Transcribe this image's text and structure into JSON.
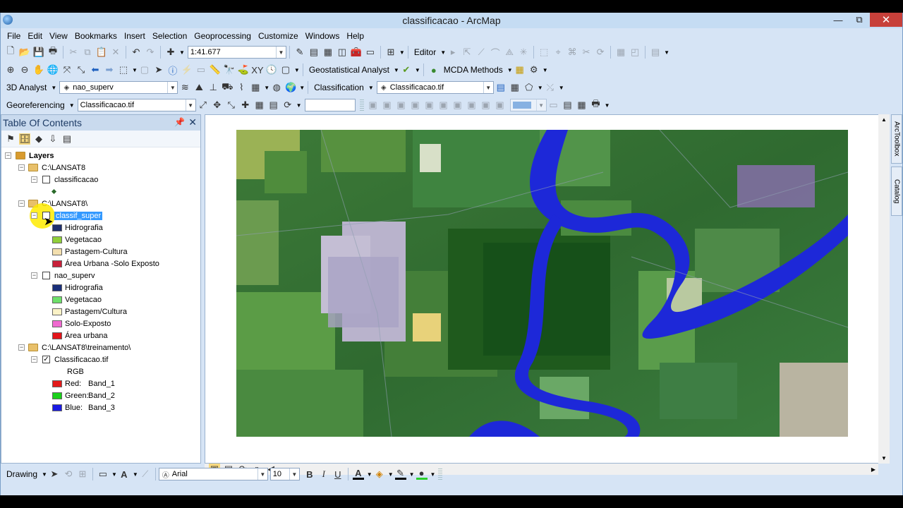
{
  "window": {
    "title": "classificacao - ArcMap",
    "minimize": "—",
    "restore": "⧉",
    "close": "✕"
  },
  "menu": [
    "File",
    "Edit",
    "View",
    "Bookmarks",
    "Insert",
    "Selection",
    "Geoprocessing",
    "Customize",
    "Windows",
    "Help"
  ],
  "toolbar1": {
    "scale": "1:41.677",
    "editor": "Editor"
  },
  "toolbar2": {
    "geostat": "Geostatistical Analyst",
    "mcda": "MCDA Methods"
  },
  "toolbar3": {
    "analyst3d": "3D Analyst",
    "layer3d": "nao_superv",
    "classification": "Classification",
    "class_layer": "Classificacao.tif"
  },
  "toolbar4": {
    "georef": "Georeferencing",
    "georef_layer": "Classificacao.tif"
  },
  "toc": {
    "title": "Table Of Contents",
    "root": "Layers",
    "groups": [
      {
        "path": "C:\\LANSAT8",
        "layers": [
          {
            "name": "classificacao"
          }
        ]
      },
      {
        "path": "C:\\LANSAT8\\",
        "layers": [
          {
            "name": "classif_super",
            "classes": [
              {
                "label": "Hidrografia",
                "color": "#1f2f6e"
              },
              {
                "label": "Vegetacao",
                "color": "#8fcf3a"
              },
              {
                "label": "Pastagem-Cultura",
                "color": "#f3dfae"
              },
              {
                "label": "Área Urbana -Solo Exposto",
                "color": "#c8213a"
              }
            ]
          },
          {
            "name": "nao_superv",
            "classes": [
              {
                "label": "Hidrografia",
                "color": "#1a2f7a"
              },
              {
                "label": "Vegetacao",
                "color": "#6ee06a"
              },
              {
                "label": "Pastagem/Cultura",
                "color": "#fbf2c6"
              },
              {
                "label": "Solo-Exposto",
                "color": "#f06ad0"
              },
              {
                "label": "Área urbana",
                "color": "#e3141a"
              }
            ]
          }
        ]
      },
      {
        "path": "C:\\LANSAT8\\treinamento\\",
        "layers": [
          {
            "name": "Classificacao.tif",
            "rgb_label": "RGB",
            "bands": [
              {
                "label": "Red:",
                "band": "Band_1",
                "color": "#e31a1a"
              },
              {
                "label": "Green:",
                "band": "Band_2",
                "color": "#1ad01a"
              },
              {
                "label": "Blue:",
                "band": "Band_3",
                "color": "#1a1ae3"
              }
            ]
          }
        ]
      }
    ]
  },
  "sidetabs": [
    "ArcToolbox",
    "Catalog"
  ],
  "drawing": {
    "label": "Drawing",
    "font": "Arial",
    "size": "10"
  }
}
